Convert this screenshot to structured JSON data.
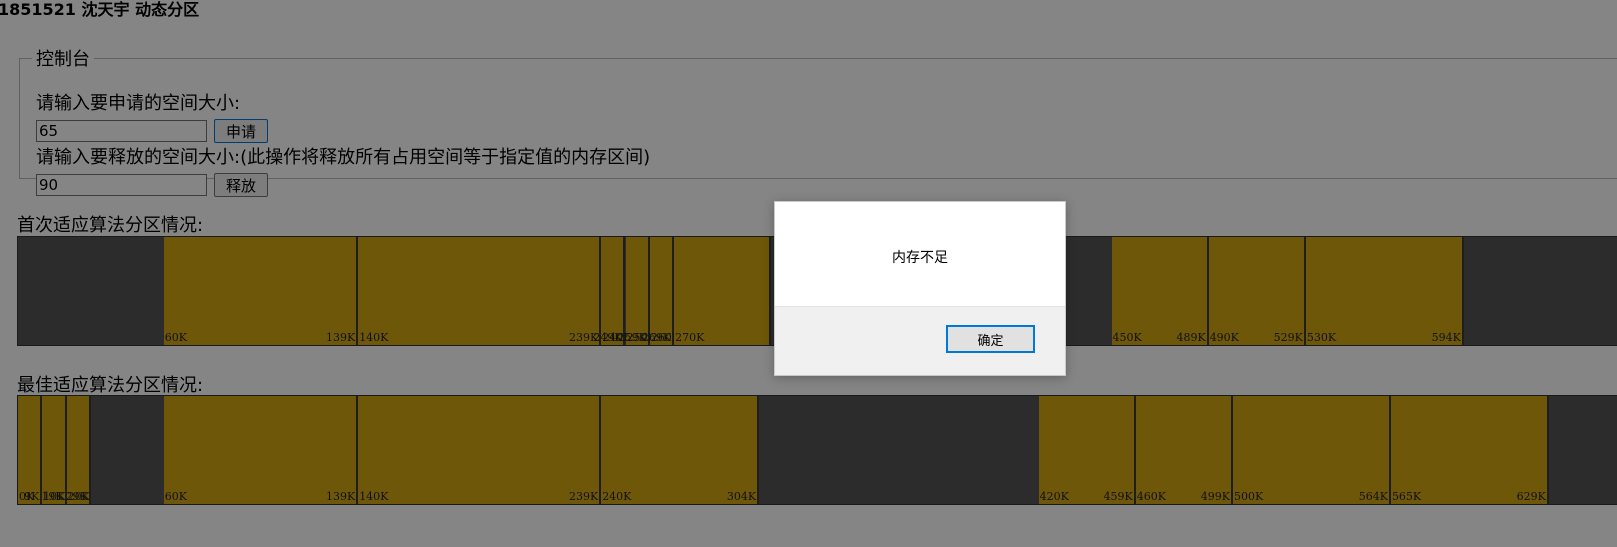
{
  "page": {
    "title": "1851521 沈天宇 动态分区"
  },
  "console": {
    "legend": "控制台",
    "request": {
      "label": "请输入要申请的空间大小:",
      "value": "65",
      "button": "申请"
    },
    "release": {
      "label": "请输入要释放的空间大小:(此操作将释放所有占用空间等于指定值的内存区间)",
      "value": "90",
      "button": "释放"
    }
  },
  "colors": {
    "used": "#d4a812",
    "free": "#555555",
    "overlay": "rgba(0,0,0,0.48)",
    "focus_border": "#0078d7"
  },
  "memory_total_k": 640,
  "first_fit": {
    "title": "首次适应算法分区情况:",
    "blocks": [
      {
        "start": 60,
        "end": 139,
        "start_label": "60K",
        "end_label": "139K"
      },
      {
        "start": 140,
        "end": 239,
        "start_label": "140K",
        "end_label": "239K"
      },
      {
        "start": 240,
        "end": 249,
        "start_label": "240K",
        "end_label": "249K"
      },
      {
        "start": 250,
        "end": 259,
        "start_label": "250K",
        "end_label": "259K"
      },
      {
        "start": 260,
        "end": 269,
        "start_label": "260K",
        "end_label": "269K"
      },
      {
        "start": 270,
        "end": 309,
        "start_label": "270K",
        "end_label": ""
      },
      {
        "start": 450,
        "end": 489,
        "start_label": "450K",
        "end_label": "489K"
      },
      {
        "start": 490,
        "end": 529,
        "start_label": "490K",
        "end_label": "529K"
      },
      {
        "start": 530,
        "end": 594,
        "start_label": "530K",
        "end_label": "594K"
      }
    ]
  },
  "best_fit": {
    "title": "最佳适应算法分区情况:",
    "blocks": [
      {
        "start": 0,
        "end": 9,
        "start_label": "0K",
        "end_label": "9K"
      },
      {
        "start": 10,
        "end": 19,
        "start_label": "10K",
        "end_label": "19K"
      },
      {
        "start": 20,
        "end": 29,
        "start_label": "20K",
        "end_label": "29K"
      },
      {
        "start": 60,
        "end": 139,
        "start_label": "60K",
        "end_label": "139K"
      },
      {
        "start": 140,
        "end": 239,
        "start_label": "140K",
        "end_label": "239K"
      },
      {
        "start": 240,
        "end": 304,
        "start_label": "240K",
        "end_label": "304K"
      },
      {
        "start": 420,
        "end": 459,
        "start_label": "420K",
        "end_label": "459K"
      },
      {
        "start": 460,
        "end": 499,
        "start_label": "460K",
        "end_label": "499K"
      },
      {
        "start": 500,
        "end": 564,
        "start_label": "500K",
        "end_label": "564K"
      },
      {
        "start": 565,
        "end": 629,
        "start_label": "565K",
        "end_label": "629K"
      }
    ]
  },
  "dialog": {
    "message": "内存不足",
    "ok": "确定"
  }
}
